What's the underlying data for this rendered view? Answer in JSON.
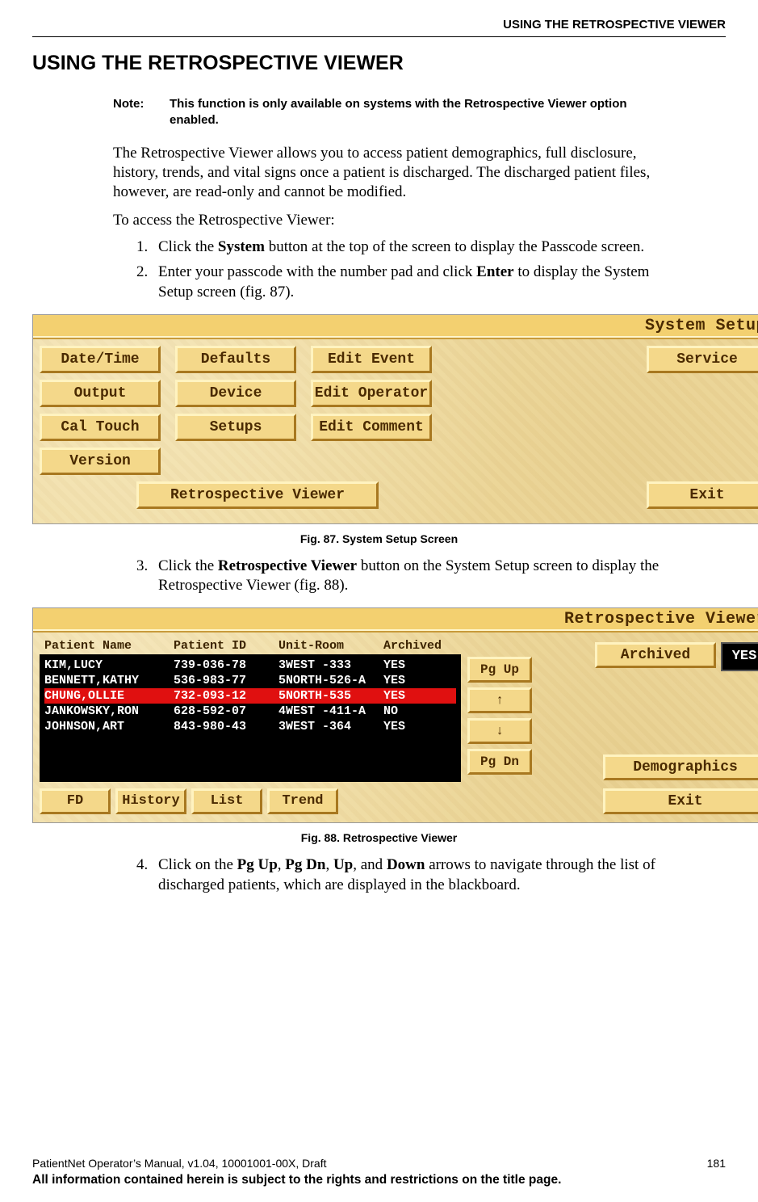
{
  "header": {
    "running": "USING THE RETROSPECTIVE VIEWER"
  },
  "title": "USING THE RETROSPECTIVE VIEWER",
  "note": {
    "label": "Note:",
    "text": "This function is only available on systems with the Retrospective Viewer option enabled."
  },
  "paragraphs": {
    "intro": "The Retrospective Viewer allows you to access patient demographics, full disclosure, history, trends, and vital signs once a patient is discharged. The discharged patient files, however, are read-only and cannot be modified.",
    "lead": "To access the Retrospective Viewer:"
  },
  "steps": {
    "s1a": "Click the ",
    "s1b": "System",
    "s1c": " button at the top of the screen to display the Passcode screen.",
    "s2a": "Enter your passcode with the number pad and click ",
    "s2b": "Enter",
    "s2c": " to display the Sys­tem Setup screen (fig. 87).",
    "s3a": "Click the ",
    "s3b": "Retrospective Viewer",
    "s3c": " button on the System Setup screen to display the Retrospective Viewer (fig. 88).",
    "s4a": "Click on the ",
    "s4b": "Pg Up",
    "s4c": ", ",
    "s4d": "Pg Dn",
    "s4e": ", ",
    "s4f": "Up",
    "s4g": ", and ",
    "s4h": "Down",
    "s4i": " arrows to navigate through the list of discharged patients, which are displayed in the blackboard."
  },
  "fig87": {
    "title": "System Setup",
    "caption": "Fig. 87. System Setup Screen",
    "buttons": {
      "date_time": "Date/Time",
      "defaults": "Defaults",
      "edit_event": "Edit Event",
      "service": "Service",
      "output": "Output",
      "device": "Device",
      "edit_operator": "Edit Operator",
      "cal_touch": "Cal Touch",
      "setups": "Setups",
      "edit_comment": "Edit Comment",
      "version": "Version",
      "retro": "Retrospective Viewer",
      "exit": "Exit"
    }
  },
  "fig88": {
    "title": "Retrospective Viewer",
    "caption": "Fig. 88. Retrospective Viewer",
    "headers": {
      "name": "Patient  Name",
      "id": "Patient  ID",
      "unit": "Unit-Room",
      "arch": "Archived"
    },
    "rows": [
      {
        "name": "KIM,LUCY",
        "id": "739-036-78",
        "unit": "3WEST -333",
        "arch": "YES",
        "selected": false
      },
      {
        "name": "BENNETT,KATHY",
        "id": "536-983-77",
        "unit": "5NORTH-526-A",
        "arch": "YES",
        "selected": false
      },
      {
        "name": "CHUNG,OLLIE",
        "id": "732-093-12",
        "unit": "5NORTH-535",
        "arch": "YES",
        "selected": true
      },
      {
        "name": "JANKOWSKY,RON",
        "id": "628-592-07",
        "unit": "4WEST -411-A",
        "arch": "NO",
        "selected": false
      },
      {
        "name": "JOHNSON,ART",
        "id": "843-980-43",
        "unit": "3WEST -364",
        "arch": "YES",
        "selected": false
      }
    ],
    "nav": {
      "pgup": "Pg Up",
      "up": "↑",
      "down": "↓",
      "pgdn": "Pg Dn"
    },
    "bottom": {
      "fd": "FD",
      "history": "History",
      "list": "List",
      "trend": "Trend"
    },
    "right": {
      "archived_label": "Archived",
      "archived_value": "YES",
      "demographics": "Demographics",
      "exit": "Exit"
    }
  },
  "footer": {
    "left": "PatientNet Operator’s Manual, v1.04, 10001001-00X, Draft",
    "right": "181",
    "notice": "All information contained herein is subject to the rights and restrictions on the title page."
  }
}
